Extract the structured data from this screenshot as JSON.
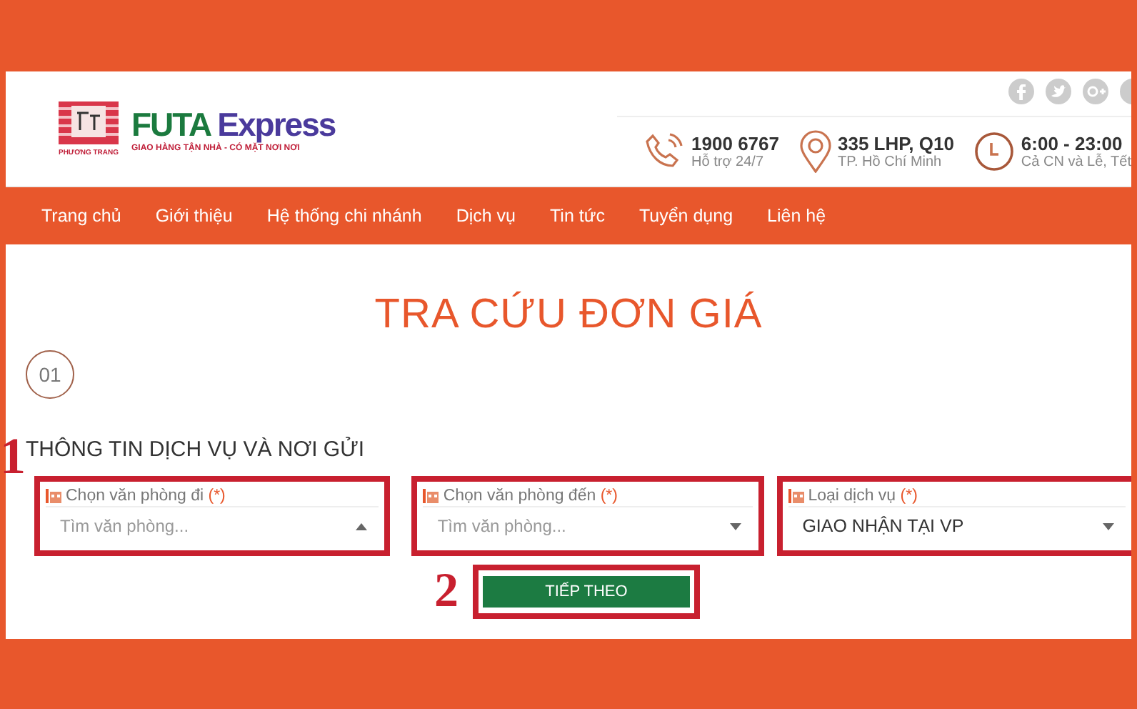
{
  "header": {
    "logo_caption": "PHƯƠNG TRANG",
    "brand": {
      "first": "FUTA",
      "second": "Express"
    },
    "slogan": "GIAO HÀNG TẬN NHÀ - CÓ MẶT NƠI NƠI",
    "contacts": [
      {
        "kind": "phone",
        "main": "1900 6767",
        "sub": "Hỗ trợ 24/7"
      },
      {
        "kind": "pin",
        "main": "335 LHP, Q10",
        "sub": "TP. Hồ Chí Minh"
      },
      {
        "kind": "clock",
        "main": "6:00 - 23:00",
        "sub": "Cả CN và Lễ, Tết"
      }
    ]
  },
  "nav": [
    "Trang chủ",
    "Giới thiệu",
    "Hệ thống chi nhánh",
    "Dịch vụ",
    "Tin tức",
    "Tuyển dụng",
    "Liên hệ"
  ],
  "page_title": "TRA CỨU ĐƠN GIÁ",
  "step": "01",
  "section_title": "THÔNG TIN DỊCH VỤ VÀ NƠI GỬI",
  "annotations": [
    "1",
    "2"
  ],
  "fields": [
    {
      "label": "Chọn văn phòng đi",
      "required": "(*)",
      "placeholder": "Tìm văn phòng...",
      "expanded": true
    },
    {
      "label": "Chọn văn phòng đến",
      "required": "(*)",
      "placeholder": "Tìm văn phòng...",
      "expanded": false
    },
    {
      "label": "Loại dịch vụ",
      "required": "(*)",
      "value": "GIAO NHẬN TẠI VP",
      "expanded": false
    }
  ],
  "next_button": "TIẾP THEO"
}
